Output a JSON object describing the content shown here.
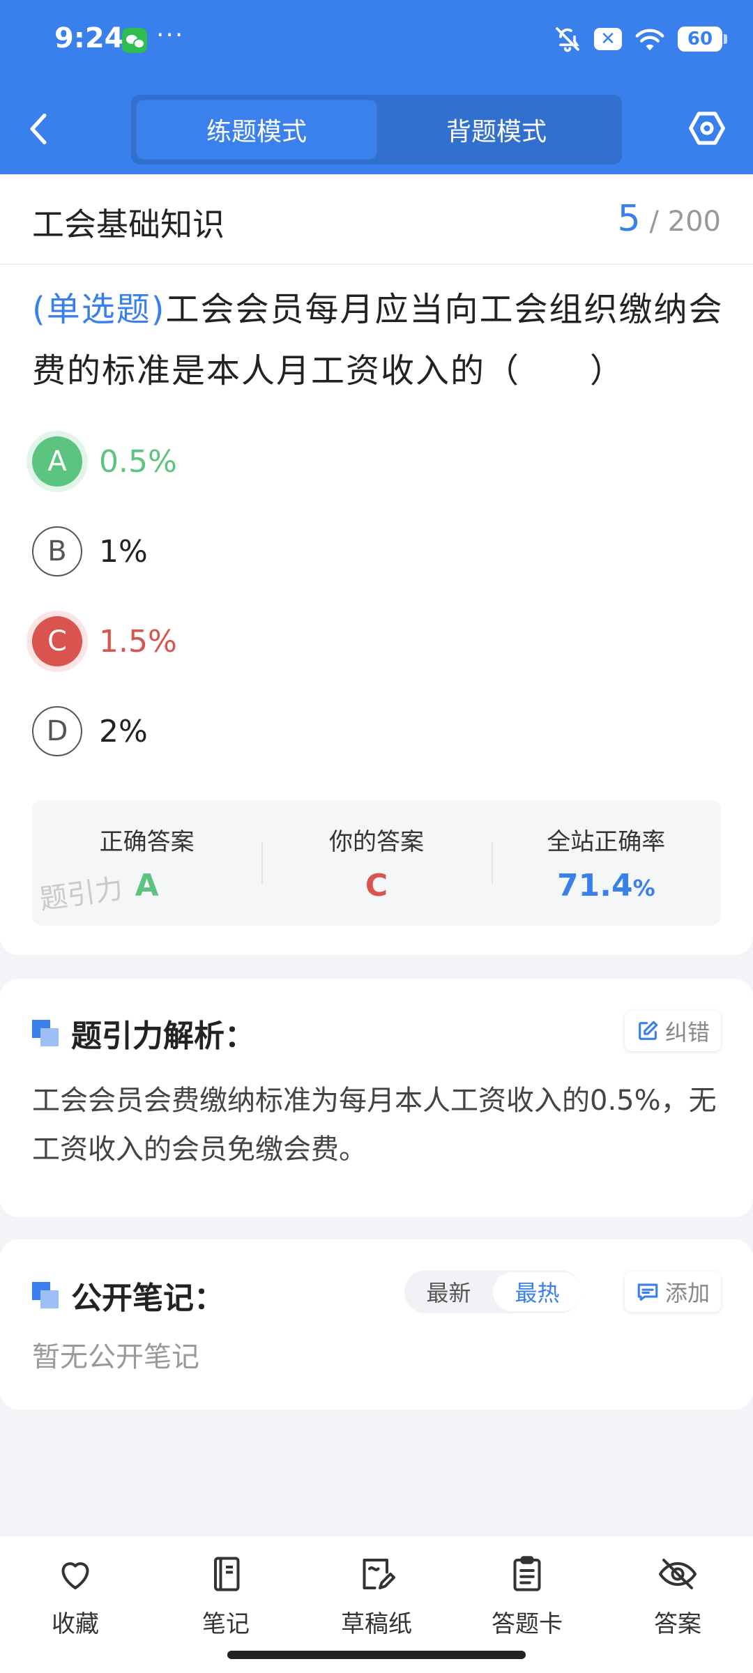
{
  "status_bar": {
    "time": "9:24",
    "dots": "···",
    "x_badge": "✕",
    "battery": "60"
  },
  "header": {
    "modes": [
      "练题模式",
      "背题模式"
    ],
    "active_mode": 0
  },
  "subject": {
    "title": "工会基础知识",
    "current": "5",
    "total_text": "/ 200"
  },
  "question": {
    "type": "(单选题)",
    "text": "工会会员每月应当向工会组织缴纳会费的标准是本人月工资收入的（　　）",
    "options": [
      {
        "letter": "A",
        "text": "0.5%",
        "state": "correct"
      },
      {
        "letter": "B",
        "text": "1%",
        "state": "normal"
      },
      {
        "letter": "C",
        "text": "1.5%",
        "state": "wrong"
      },
      {
        "letter": "D",
        "text": "2%",
        "state": "normal"
      }
    ]
  },
  "result": {
    "correct_label": "正确答案",
    "correct_value": "A",
    "yours_label": "你的答案",
    "yours_value": "C",
    "rate_label": "全站正确率",
    "rate_value": "71.4",
    "rate_unit": "%",
    "watermark": "题引力"
  },
  "analysis": {
    "title": "题引力解析：",
    "report_label": "纠错",
    "text": "工会会员会费缴纳标准为每月本人工资收入的0.5%，无工资收入的会员免缴会费。"
  },
  "notes": {
    "title": "公开笔记：",
    "sort_options": [
      "最新",
      "最热"
    ],
    "active_sort": 1,
    "add_label": "添加",
    "empty_text": "暂无公开笔记"
  },
  "bottom_nav": [
    {
      "label": "收藏",
      "icon": "heart-icon"
    },
    {
      "label": "笔记",
      "icon": "notebook-icon"
    },
    {
      "label": "草稿纸",
      "icon": "draft-paper-icon"
    },
    {
      "label": "答题卡",
      "icon": "answer-sheet-icon"
    },
    {
      "label": "答案",
      "icon": "eye-off-icon"
    }
  ],
  "colors": {
    "primary": "#3a80ec",
    "correct": "#5bc57f",
    "wrong": "#d9534f"
  }
}
